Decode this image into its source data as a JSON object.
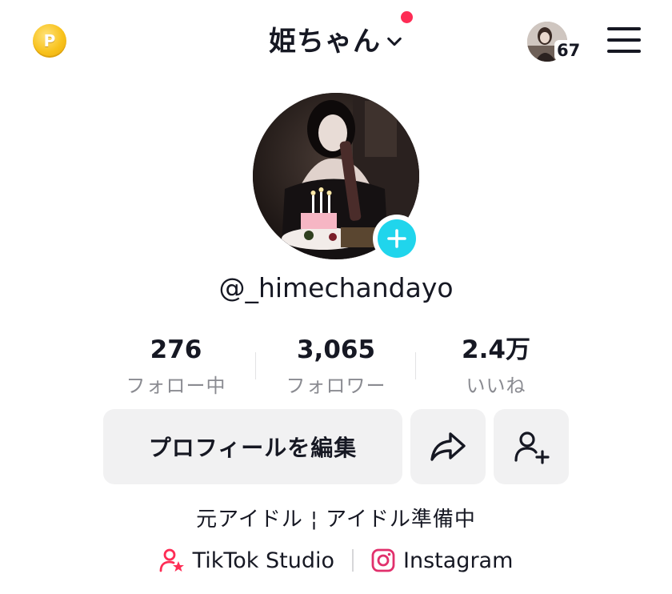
{
  "header": {
    "coin_icon": "coin-icon",
    "coin_letter": "P",
    "account_name": "姫ちゃん",
    "notification_dot_color": "#fe2c55",
    "story_badge_count": "67",
    "menu_icon": "hamburger-menu-icon"
  },
  "profile": {
    "username": "@_himechandayo",
    "add_icon_color": "#20d5ec"
  },
  "stats": [
    {
      "value": "276",
      "label": "フォロー中"
    },
    {
      "value": "3,065",
      "label": "フォロワー"
    },
    {
      "value": "2.4万",
      "label": "いいね"
    }
  ],
  "actions": {
    "edit_profile_label": "プロフィールを編集",
    "share_icon": "share-arrow-icon",
    "add_friend_icon": "add-friend-icon"
  },
  "bio": "元アイドル ¦ アイドル準備中",
  "links": [
    {
      "label": "TikTok Studio",
      "icon": "tiktok-studio-icon",
      "icon_color": "#fe2c55"
    },
    {
      "label": "Instagram",
      "icon": "instagram-icon",
      "icon_color": "#e1306c"
    }
  ]
}
